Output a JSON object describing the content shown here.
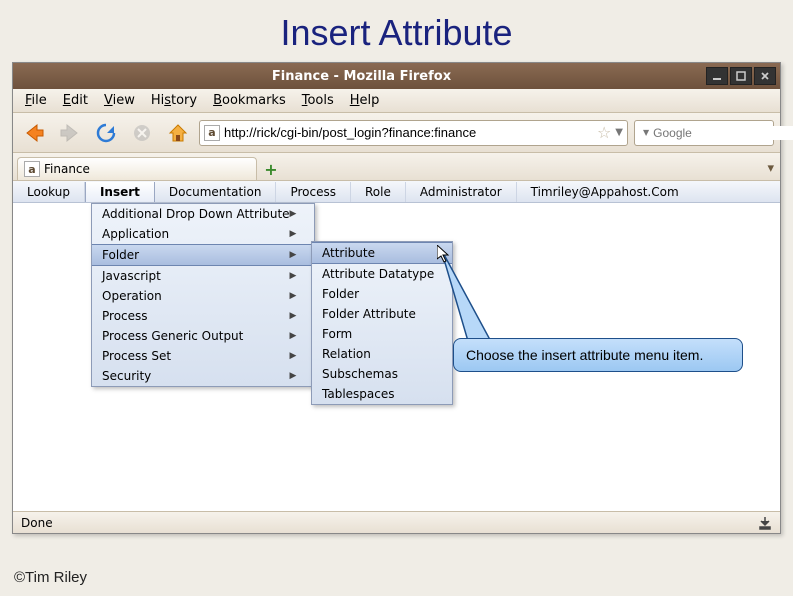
{
  "slide": {
    "title": "Insert Attribute",
    "copyright": "©Tim Riley"
  },
  "window": {
    "title": "Finance - Mozilla Firefox",
    "menubar": [
      "File",
      "Edit",
      "View",
      "History",
      "Bookmarks",
      "Tools",
      "Help"
    ],
    "url": "http://rick/cgi-bin/post_login?finance:finance",
    "search_placeholder": "Google",
    "tab_label": "Finance",
    "status": "Done"
  },
  "appnav": {
    "items": [
      "Lookup",
      "Insert",
      "Documentation",
      "Process",
      "Role",
      "Administrator"
    ],
    "user": "Timriley@Appahost.Com",
    "active_index": 1
  },
  "insert_menu": {
    "items": [
      {
        "label": "Additional Drop Down Attribute"
      },
      {
        "label": "Application"
      },
      {
        "label": "Folder",
        "hover": true
      },
      {
        "label": "Javascript"
      },
      {
        "label": "Operation"
      },
      {
        "label": "Process"
      },
      {
        "label": "Process Generic Output"
      },
      {
        "label": "Process Set"
      },
      {
        "label": "Security"
      }
    ]
  },
  "folder_submenu": {
    "items": [
      {
        "label": "Attribute",
        "hover": true
      },
      {
        "label": "Attribute Datatype"
      },
      {
        "label": "Folder"
      },
      {
        "label": "Folder Attribute"
      },
      {
        "label": "Form"
      },
      {
        "label": "Relation"
      },
      {
        "label": "Subschemas"
      },
      {
        "label": "Tablespaces"
      }
    ]
  },
  "callout": {
    "text": "Choose the insert attribute menu item."
  }
}
